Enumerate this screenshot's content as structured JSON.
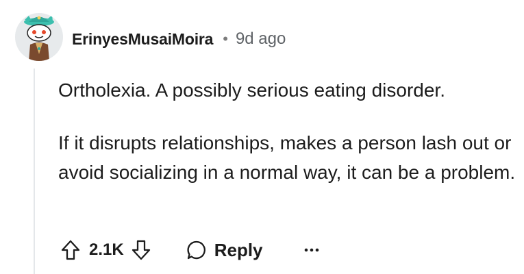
{
  "comment": {
    "username": "ErinyesMusaiMoira",
    "separator": "•",
    "timestamp": "9d ago",
    "paragraphs": [
      "Ortholexia. A possibly serious eating disorder.",
      "If it disrupts relationships, makes a person lash out or avoid socializing in a normal way, it can be a problem."
    ]
  },
  "actions": {
    "score": "2.1K",
    "reply_label": "Reply",
    "upvote_icon": "upvote-arrow-icon",
    "downvote_icon": "downvote-arrow-icon",
    "reply_icon": "speech-bubble-icon",
    "more_icon": "ellipsis-icon"
  },
  "colors": {
    "text": "#1c1c1c",
    "meta": "#5f6367",
    "thread_line": "#e4e7ea",
    "avatar_bg": "#e7eaec",
    "avatar_hat": "#3cbfae"
  }
}
